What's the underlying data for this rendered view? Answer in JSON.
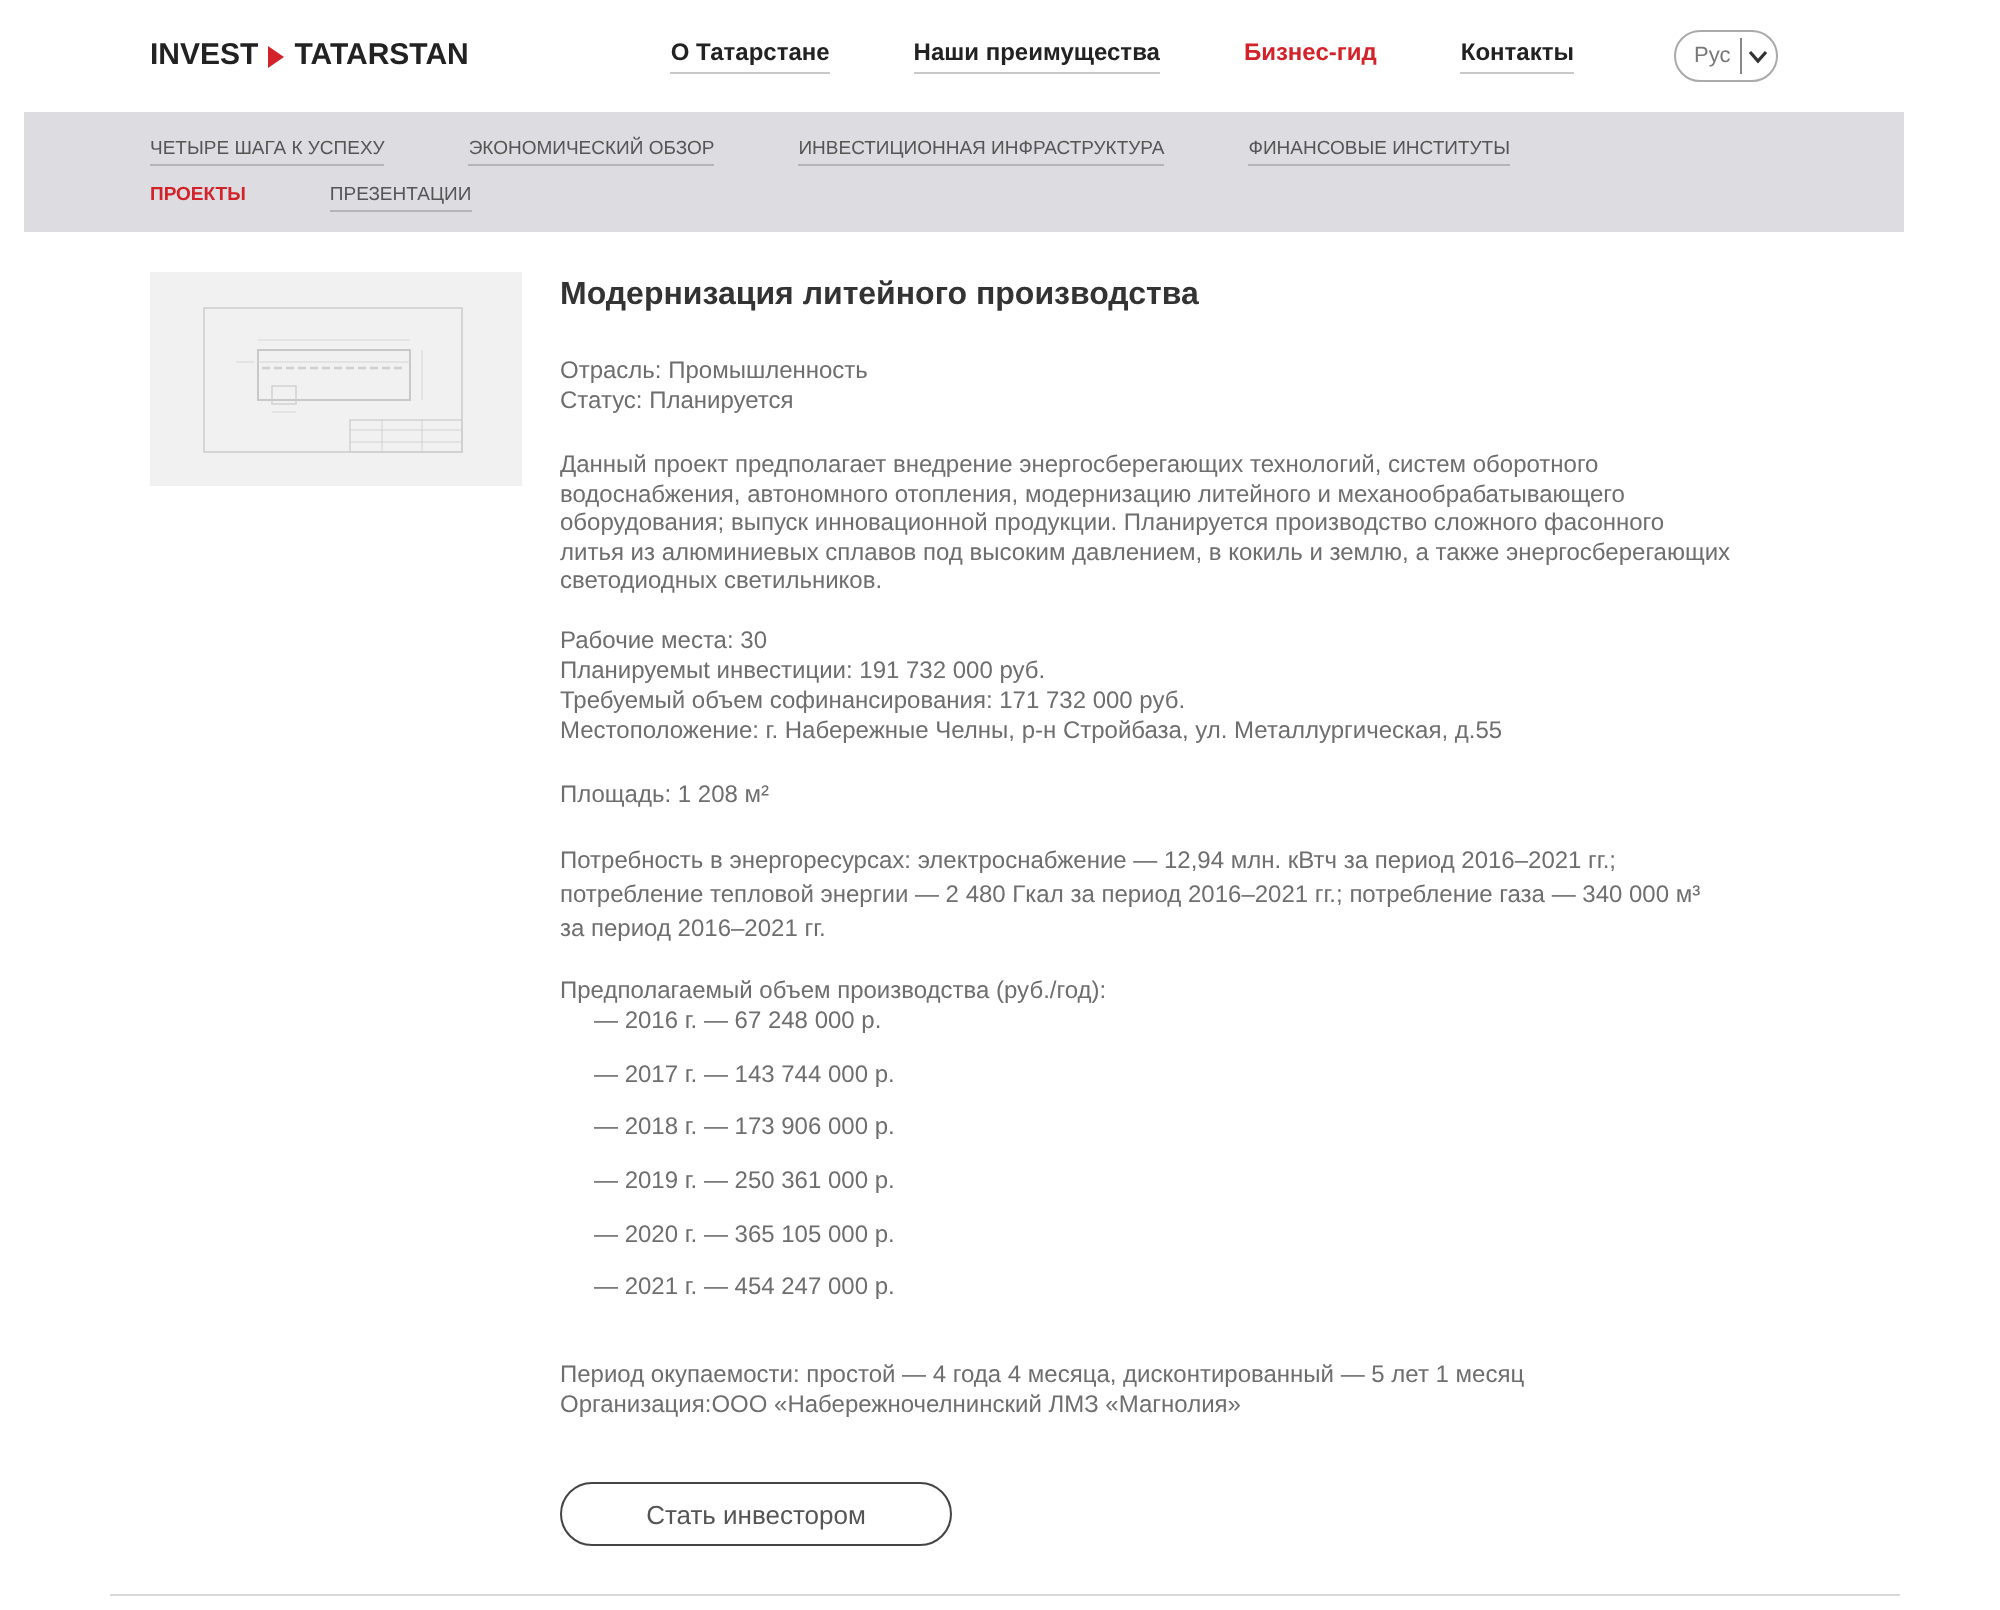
{
  "header": {
    "logo": {
      "left": "INVEST",
      "right": "TATARSTAN"
    },
    "nav": [
      {
        "label": "О Татарстане",
        "selected": false
      },
      {
        "label": "Наши преимущества",
        "selected": false
      },
      {
        "label": "Бизнес-гид",
        "selected": true
      },
      {
        "label": "Контакты",
        "selected": false
      }
    ],
    "language": {
      "value": "Рус"
    }
  },
  "subnav": [
    {
      "label": "ЧЕТЫРЕ ШАГА К УСПЕХУ",
      "selected": false
    },
    {
      "label": "ЭКОНОМИЧЕСКИЙ ОБЗОР",
      "selected": false
    },
    {
      "label": "ИНВЕСТИЦИОННАЯ ИНФРАСТРУКТУРА",
      "selected": false
    },
    {
      "label": "ФИНАНСОВЫЕ ИНСТИТУТЫ",
      "selected": false
    },
    {
      "label": "ПРОЕКТЫ",
      "selected": true
    },
    {
      "label": "ПРЕЗЕНТАЦИИ",
      "selected": false
    }
  ],
  "project": {
    "title": "Модернизация литейного производства",
    "meta": [
      "Отрасль: Промышленность",
      "Статус: Планируется"
    ],
    "description": "Данный проект предполагает внедрение энергосберегающих технологий, систем оборотного водоснабжения, автономного отопления, модернизацию литейного и механообрабатывающего оборудования; выпуск инновационной продукции. Планируется производство сложного фасонного литья из алюминиевых сплавов под высоким давлением, в кокиль и землю, а также энергосберегающих светодиодных светильников.",
    "facts": [
      "Рабочие места: 30",
      "Планируемыt инвестиции: 191 732 000 руб.",
      "Требуемый объем софинансирования: 171 732 000 руб.",
      "Местоположение: г. Набережные Челны, р-н Стройбаза, ул. Металлургическая, д.55"
    ],
    "area": "Площадь: 1 208 м²",
    "energy": "Потребность в энергоресурсах: электроснабжение — 12,94 млн. кВтч за период 2016–2021 гг.; потребление тепловой энергии — 2 480 Гкал за период 2016–2021 гг.; потребление газа — 340 000 м³ за период 2016–2021 гг.",
    "production": {
      "label": "Предполагаемый объем производства (руб./год):",
      "items": [
        "— 2016 г. — 67 248 000 р.",
        "— 2017 г. — 143 744 000 р.",
        "— 2018 г. — 173 906 000 р.",
        "— 2019 г. — 250 361 000 р.",
        "— 2020 г. — 365 105 000 р.",
        "— 2021 г. — 454 247 000 р."
      ]
    },
    "closing": [
      "Период окупаемости: простой — 4 года 4 месяца, дисконтированный — 5 лет 1 месяц",
      "Организация:ООО «Набережночелнинский ЛМЗ «Магнолия»"
    ],
    "button": "Стать инвестором"
  }
}
